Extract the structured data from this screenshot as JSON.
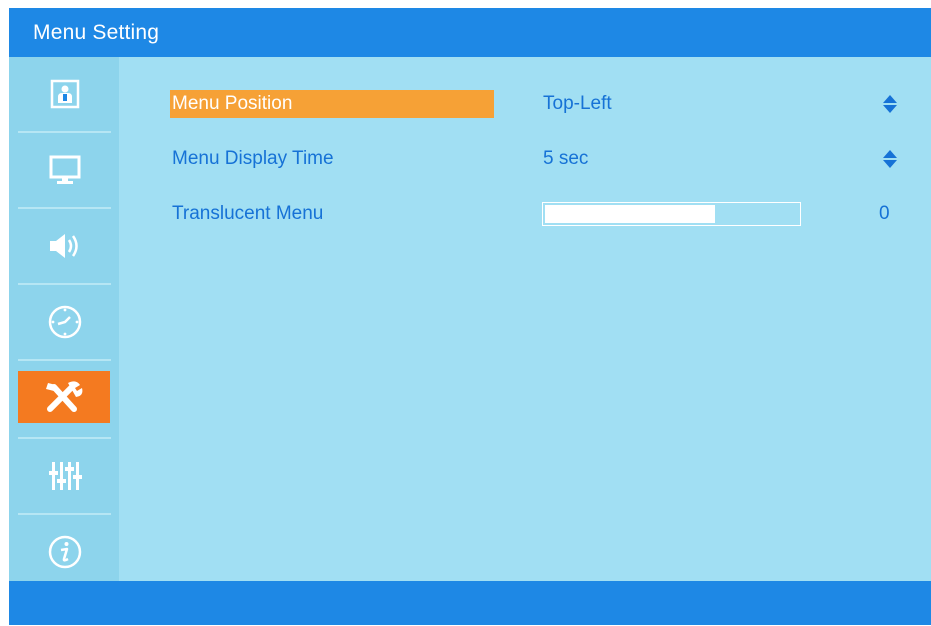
{
  "window": {
    "title": "Menu Setting"
  },
  "sidebar": {
    "items": [
      {
        "icon": "picture-person-icon",
        "active": false
      },
      {
        "icon": "monitor-icon",
        "active": false
      },
      {
        "icon": "speaker-icon",
        "active": false
      },
      {
        "icon": "clock-icon",
        "active": false
      },
      {
        "icon": "tools-icon",
        "active": true
      },
      {
        "icon": "sliders-icon",
        "active": false
      },
      {
        "icon": "info-icon",
        "active": false
      }
    ]
  },
  "settings": {
    "menu_position": {
      "label": "Menu Position",
      "value": "Top-Left"
    },
    "menu_display_time": {
      "label": "Menu Display Time",
      "value": "5 sec"
    },
    "translucent_menu": {
      "label": "Translucent Menu",
      "value": "0",
      "level": 0.67
    }
  },
  "colors": {
    "header": "#1e88e5",
    "sidebar": "#8dd4ec",
    "content": "#a1dff3",
    "accent_active": "#f47a20",
    "accent_selected": "#f6a136",
    "text": "#1672d6"
  }
}
